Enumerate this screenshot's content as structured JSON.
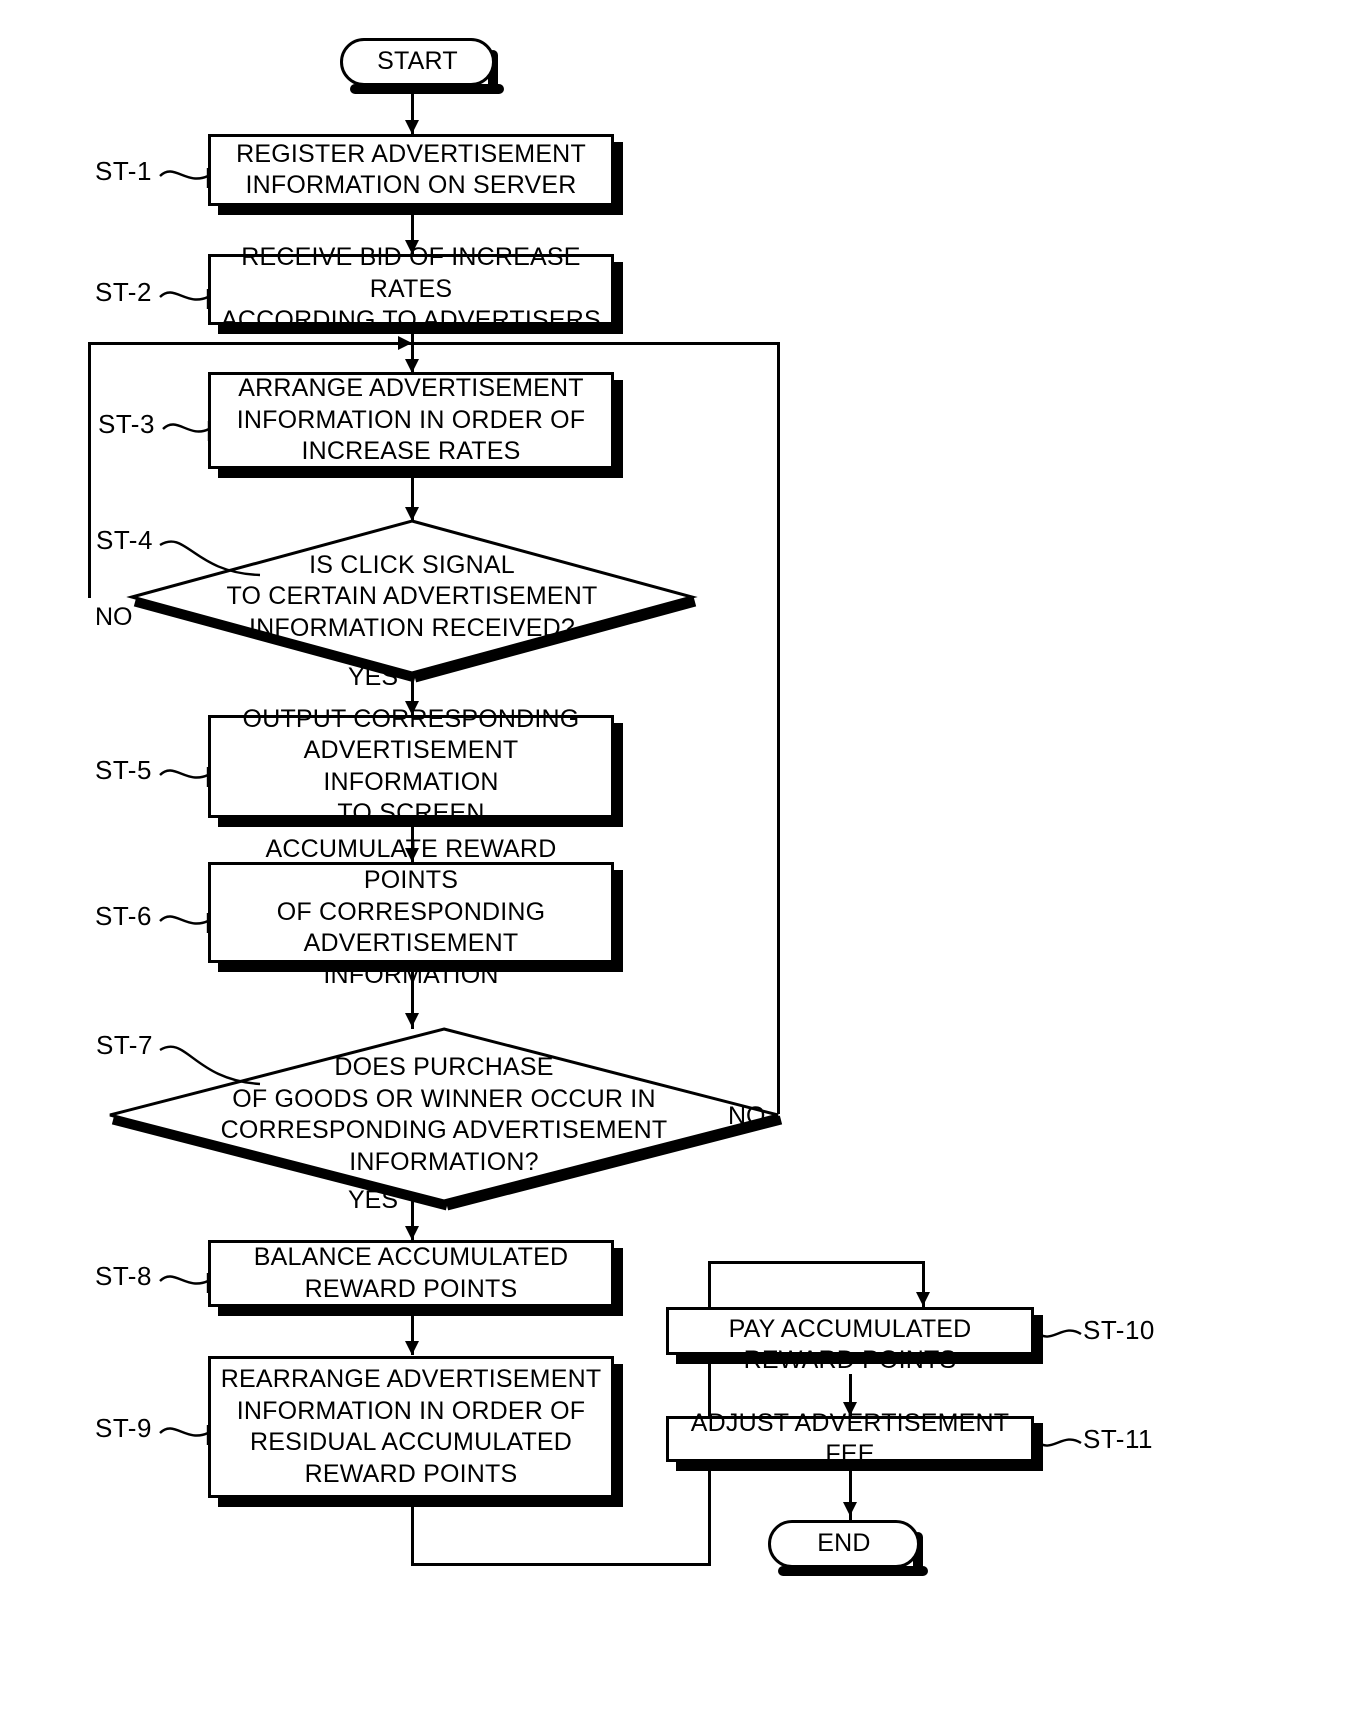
{
  "diagram": {
    "title": "Advertisement reward points process flowchart",
    "type": "flowchart",
    "stroke_color": "#000000",
    "background_color": "#ffffff"
  },
  "nodes": {
    "start": {
      "id": "START",
      "shape": "terminal",
      "label": "START"
    },
    "st1": {
      "id": "ST-1",
      "shape": "process",
      "label": "REGISTER ADVERTISEMENT\nINFORMATION ON SERVER",
      "lines": [
        "REGISTER ADVERTISEMENT",
        "INFORMATION ON SERVER"
      ]
    },
    "st2": {
      "id": "ST-2",
      "shape": "process",
      "label": "RECEIVE BID OF INCREASE RATES\nACCORDING TO ADVERTISERS",
      "lines": [
        "RECEIVE BID OF INCREASE RATES",
        "ACCORDING TO ADVERTISERS"
      ]
    },
    "st3": {
      "id": "ST-3",
      "shape": "process",
      "label": "ARRANGE ADVERTISEMENT\nINFORMATION IN ORDER OF\nINCREASE RATES",
      "lines": [
        "ARRANGE ADVERTISEMENT",
        "INFORMATION IN ORDER OF",
        "INCREASE RATES"
      ]
    },
    "st4": {
      "id": "ST-4",
      "shape": "decision",
      "label": "IS CLICK SIGNAL\nTO CERTAIN ADVERTISEMENT\nINFORMATION RECEIVED?",
      "lines": [
        "IS CLICK SIGNAL",
        "TO CERTAIN ADVERTISEMENT",
        "INFORMATION RECEIVED?"
      ],
      "branch_yes": "YES",
      "branch_no": "NO"
    },
    "st5": {
      "id": "ST-5",
      "shape": "process",
      "label": "OUTPUT CORRESPONDING\nADVERTISEMENT INFORMATION\nTO SCREEN",
      "lines": [
        "OUTPUT CORRESPONDING",
        "ADVERTISEMENT INFORMATION",
        "TO SCREEN"
      ]
    },
    "st6": {
      "id": "ST-6",
      "shape": "process",
      "label": "ACCUMULATE REWARD POINTS\nOF CORRESPONDING\nADVERTISEMENT INFORMATION",
      "lines": [
        "ACCUMULATE REWARD POINTS",
        "OF CORRESPONDING",
        "ADVERTISEMENT INFORMATION"
      ]
    },
    "st7": {
      "id": "ST-7",
      "shape": "decision",
      "label": "DOES PURCHASE\nOF GOODS OR WINNER OCCUR IN\nCORRESPONDING ADVERTISEMENT\nINFORMATION?",
      "lines": [
        "DOES PURCHASE",
        "OF GOODS OR WINNER OCCUR IN",
        "CORRESPONDING ADVERTISEMENT",
        "INFORMATION?"
      ],
      "branch_yes": "YES",
      "branch_no": "NO"
    },
    "st8": {
      "id": "ST-8",
      "shape": "process",
      "label": "BALANCE ACCUMULATED\nREWARD POINTS",
      "lines": [
        "BALANCE ACCUMULATED",
        "REWARD POINTS"
      ]
    },
    "st9": {
      "id": "ST-9",
      "shape": "process",
      "label": "REARRANGE ADVERTISEMENT\nINFORMATION IN ORDER OF\nRESIDUAL ACCUMULATED\nREWARD POINTS",
      "lines": [
        "REARRANGE ADVERTISEMENT",
        "INFORMATION IN ORDER OF",
        "RESIDUAL ACCUMULATED",
        "REWARD POINTS"
      ]
    },
    "st10": {
      "id": "ST-10",
      "shape": "process",
      "label": "PAY ACCUMULATED\nREWARD POINTS",
      "lines": [
        "PAY ACCUMULATED",
        "REWARD POINTS"
      ]
    },
    "st11": {
      "id": "ST-11",
      "shape": "process",
      "label": "ADJUST ADVERTISEMENT FEE",
      "lines": [
        "ADJUST ADVERTISEMENT FEE"
      ]
    },
    "end": {
      "id": "END",
      "shape": "terminal",
      "label": "END"
    }
  },
  "branch_labels": {
    "st4_no": "NO",
    "st4_yes": "YES",
    "st7_no": "NO",
    "st7_yes": "YES"
  },
  "step_tags": {
    "st1": "ST-1",
    "st2": "ST-2",
    "st3": "ST-3",
    "st4": "ST-4",
    "st5": "ST-5",
    "st6": "ST-6",
    "st7": "ST-7",
    "st8": "ST-8",
    "st9": "ST-9",
    "st10": "ST-10",
    "st11": "ST-11"
  }
}
